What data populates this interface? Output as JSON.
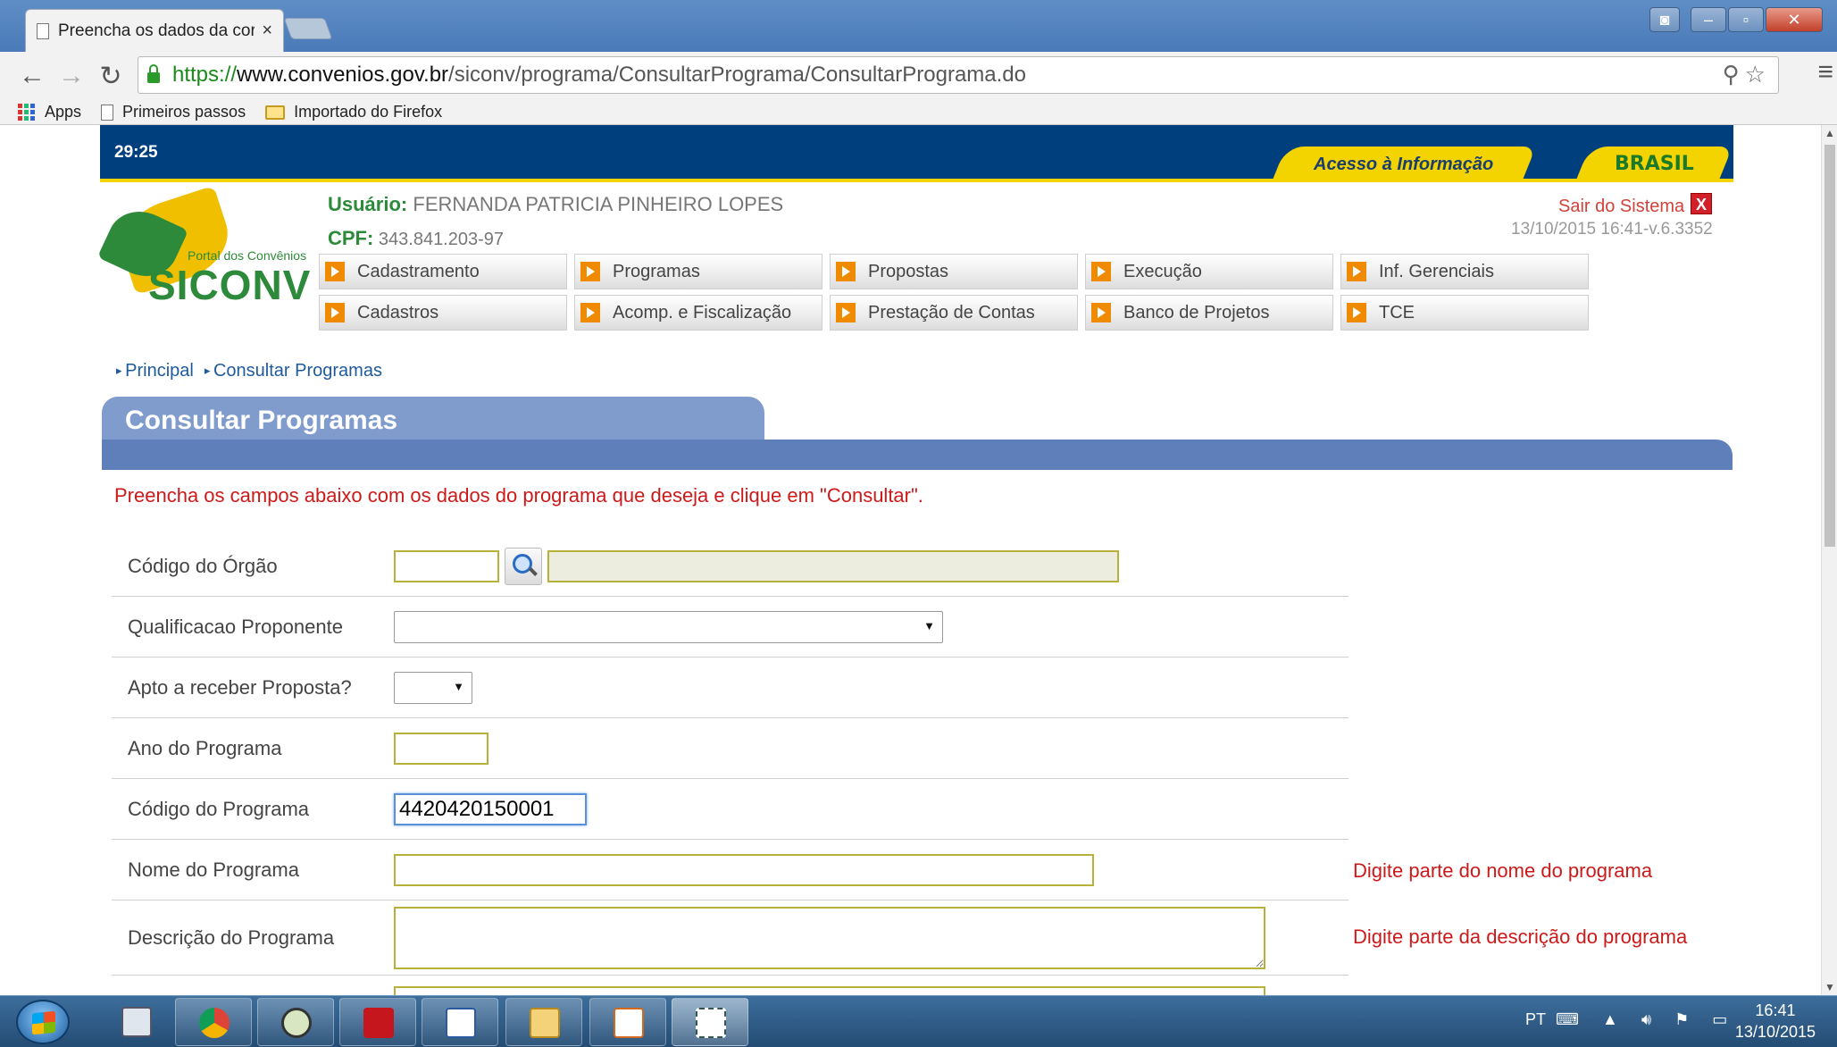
{
  "browser": {
    "tab_title": "Preencha os dados da cor",
    "tab_close": "×",
    "url_scheme": "https://",
    "url_host": "www.convenios.gov.br",
    "url_path": "/siconv/programa/ConsultarPrograma/ConsultarPrograma.do",
    "bookmarks": [
      "Apps",
      "Primeiros passos",
      "Importado do Firefox"
    ]
  },
  "site": {
    "timer": "29:25",
    "acesso_info": "Acesso à Informação",
    "brasil": "BRASIL",
    "logo_portal": "Portal dos Convênios",
    "logo_name": "SICONV",
    "user_label": "Usuário:",
    "user_name": "FERNANDA PATRICIA PINHEIRO LOPES",
    "cpf_label": "CPF:",
    "cpf_value": "343.841.203-97",
    "logout": "Sair do Sistema",
    "logout_x": "X",
    "version": "13/10/2015 16:41-v.6.3352",
    "menu": [
      "Cadastramento",
      "Programas",
      "Propostas",
      "Execução",
      "Inf. Gerenciais",
      "Cadastros",
      "Acomp. e Fiscalização",
      "Prestação de Contas",
      "Banco de Projetos",
      "TCE"
    ]
  },
  "page": {
    "breadcrumb": [
      "Principal",
      "Consultar Programas"
    ],
    "title": "Consultar Programas",
    "instructions": "Preencha os campos abaixo com os dados do programa que deseja e clique em \"Consultar\"."
  },
  "form": {
    "codigo_orgao_label": "Código do Órgão",
    "codigo_orgao_value": "",
    "codigo_orgao_desc": "",
    "qualificacao_label": "Qualificacao Proponente",
    "qualificacao_value": "",
    "apto_label": "Apto a receber Proposta?",
    "apto_value": "",
    "ano_label": "Ano do Programa",
    "ano_value": "",
    "codigo_programa_label": "Código do Programa",
    "codigo_programa_value": "4420420150001",
    "nome_label": "Nome do Programa",
    "nome_value": "",
    "nome_hint": "Digite parte do nome do programa",
    "descricao_label": "Descrição do Programa",
    "descricao_value": "",
    "descricao_hint": "Digite parte da descrição do programa"
  },
  "taskbar": {
    "lang": "PT",
    "time": "16:41",
    "date": "13/10/2015",
    "apps": [
      "calculator-icon",
      "chrome-icon",
      "network-globe-icon",
      "acrobat-icon",
      "writer-icon",
      "explorer-icon",
      "impress-icon",
      "snipping-tool-icon"
    ]
  }
}
